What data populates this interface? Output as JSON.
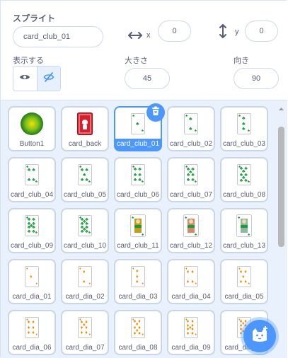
{
  "sprite_info": {
    "sprite_label": "スプライト",
    "sprite_name": "card_club_01",
    "x_label": "x",
    "x_value": "0",
    "y_label": "y",
    "y_value": "0",
    "show_label": "表示する",
    "size_label": "大きさ",
    "size_value": "45",
    "direction_label": "向き",
    "direction_value": "90"
  },
  "sprites": [
    {
      "name": "Button1",
      "kind": "button",
      "selected": false
    },
    {
      "name": "card_back",
      "kind": "back",
      "selected": false
    },
    {
      "name": "card_club_01",
      "kind": "club",
      "pips": 1,
      "selected": true
    },
    {
      "name": "card_club_02",
      "kind": "club",
      "pips": 2,
      "selected": false
    },
    {
      "name": "card_club_03",
      "kind": "club",
      "pips": 3,
      "selected": false
    },
    {
      "name": "card_club_04",
      "kind": "club",
      "pips": 4,
      "selected": false
    },
    {
      "name": "card_club_05",
      "kind": "club",
      "pips": 5,
      "selected": false
    },
    {
      "name": "card_club_06",
      "kind": "club",
      "pips": 6,
      "selected": false
    },
    {
      "name": "card_club_07",
      "kind": "club",
      "pips": 7,
      "selected": false
    },
    {
      "name": "card_club_08",
      "kind": "club",
      "pips": 8,
      "selected": false
    },
    {
      "name": "card_club_09",
      "kind": "club",
      "pips": 9,
      "selected": false
    },
    {
      "name": "card_club_10",
      "kind": "club",
      "pips": 10,
      "selected": false
    },
    {
      "name": "card_club_11",
      "kind": "face",
      "face": "jack",
      "selected": false
    },
    {
      "name": "card_club_12",
      "kind": "face",
      "face": "queen",
      "selected": false
    },
    {
      "name": "card_club_13",
      "kind": "face",
      "face": "king",
      "selected": false
    },
    {
      "name": "card_dia_01",
      "kind": "diamond",
      "pips": 1,
      "selected": false
    },
    {
      "name": "card_dia_02",
      "kind": "diamond",
      "pips": 2,
      "selected": false
    },
    {
      "name": "card_dia_03",
      "kind": "diamond",
      "pips": 3,
      "selected": false
    },
    {
      "name": "card_dia_04",
      "kind": "diamond",
      "pips": 4,
      "selected": false
    },
    {
      "name": "card_dia_05",
      "kind": "diamond",
      "pips": 5,
      "selected": false
    },
    {
      "name": "card_dia_06",
      "kind": "diamond",
      "pips": 6,
      "selected": false
    },
    {
      "name": "card_dia_07",
      "kind": "diamond",
      "pips": 7,
      "selected": false
    },
    {
      "name": "card_dia_08",
      "kind": "diamond",
      "pips": 8,
      "selected": false
    },
    {
      "name": "card_dia_09",
      "kind": "diamond",
      "pips": 9,
      "selected": false
    },
    {
      "name": "card_dia_10",
      "kind": "diamond",
      "pips": 10,
      "selected": false
    }
  ],
  "colors": {
    "accent": "#4c97ff",
    "club": "#1a9c3e",
    "diamond": "#f08a00",
    "back": "#d81e2a"
  },
  "icons": {
    "delete": "trash-icon",
    "add_sprite": "cat-add-icon",
    "show": "eye-icon",
    "hide": "eye-slash-icon"
  }
}
